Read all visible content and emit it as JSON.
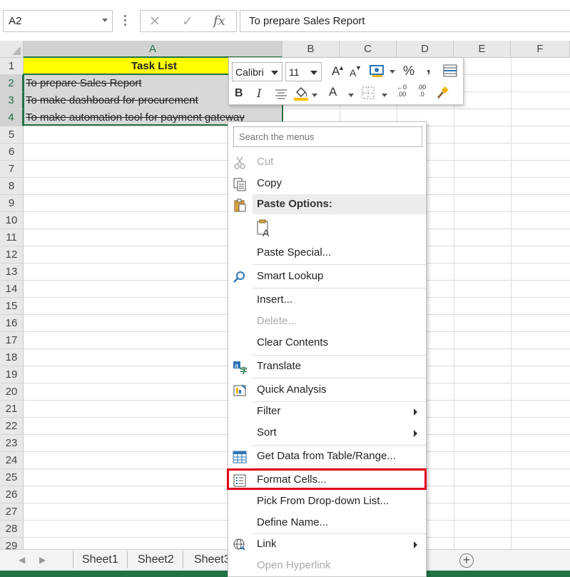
{
  "formula_bar": {
    "name_box": "A2",
    "cancel_glyph": "✕",
    "enter_glyph": "✓",
    "fx_glyph": "fx",
    "content": "To prepare Sales Report"
  },
  "grid": {
    "columns": [
      "A",
      "B",
      "C",
      "D",
      "E",
      "F"
    ],
    "rows": [
      "1",
      "2",
      "3",
      "4",
      "5",
      "6",
      "7",
      "8",
      "9",
      "10",
      "11",
      "12",
      "13",
      "14",
      "15",
      "16",
      "17",
      "18",
      "19",
      "20",
      "21",
      "22",
      "23",
      "24",
      "25",
      "26",
      "27",
      "28",
      "29"
    ],
    "cells": {
      "A1": "Task List",
      "A2": "To prepare Sales Report",
      "A3": "To make dashboard for procurement",
      "A4": "To make automation tool for payment gateway"
    },
    "colors": {
      "header_fill": "#ffff00",
      "selection": "#217346"
    }
  },
  "sheets": [
    "Sheet1",
    "Sheet2",
    "Sheet3"
  ],
  "mini_toolbar": {
    "font_name": "Calibri",
    "font_size": "11",
    "bold": "B",
    "italic": "I",
    "percent": "%",
    "comma": ",",
    "increase_font": "A",
    "decrease_font": "A",
    "font_color": "A",
    "inc_decimal": ".00",
    "dec_decimal": ".0"
  },
  "context_menu": {
    "search_placeholder": "Search the menus",
    "cut": "Cut",
    "copy": "Copy",
    "paste_options": "Paste Options:",
    "paste_special": "Paste Special...",
    "smart_lookup": "Smart Lookup",
    "insert": "Insert...",
    "delete": "Delete...",
    "clear_contents": "Clear Contents",
    "translate": "Translate",
    "quick_analysis": "Quick Analysis",
    "filter": "Filter",
    "sort": "Sort",
    "get_data": "Get Data from Table/Range...",
    "format_cells": "Format Cells...",
    "pick_dropdown": "Pick From Drop-down List...",
    "define_name": "Define Name...",
    "link": "Link",
    "open_hyperlink": "Open Hyperlink",
    "highlight_color": "#e4001b"
  }
}
